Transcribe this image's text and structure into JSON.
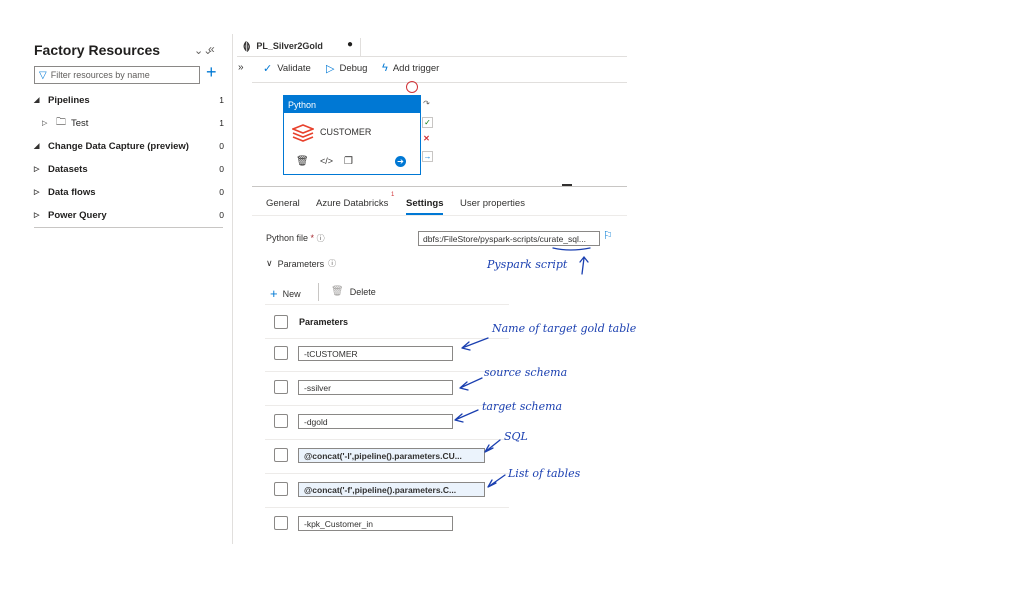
{
  "sidebar": {
    "title": "Factory Resources",
    "filter_placeholder": "Filter resources by name",
    "items": [
      {
        "label": "Pipelines",
        "count": "1",
        "expanded": true
      },
      {
        "label": "Test",
        "count": "1",
        "child": true
      },
      {
        "label": "Change Data Capture (preview)",
        "count": "0",
        "expanded": true
      },
      {
        "label": "Datasets",
        "count": "0"
      },
      {
        "label": "Data flows",
        "count": "0"
      },
      {
        "label": "Power Query",
        "count": "0"
      }
    ]
  },
  "tab": {
    "name": "PL_Silver2Gold",
    "unsaved_marker": "●"
  },
  "toolbar": {
    "validate": "Validate",
    "debug": "Debug",
    "add_trigger": "Add trigger"
  },
  "activity": {
    "type": "Python",
    "name": "CUSTOMER"
  },
  "props": {
    "tabs": [
      "General",
      "Azure Databricks",
      "Settings",
      "User properties"
    ],
    "badge": "1",
    "python_file_label": "Python file",
    "required_marker": "*",
    "python_file_value": "dbfs:/FileStore/pyspark-scripts/curate_sql...",
    "parameters_label": "Parameters",
    "new_label": "New",
    "delete_label": "Delete",
    "param_header": "Parameters",
    "params": [
      "-tCUSTOMER",
      "-ssilver",
      "-dgold",
      "@concat('-l',pipeline().parameters.CU...",
      "@concat('-f',pipeline().parameters.C...",
      "-kpk_Customer_in"
    ]
  },
  "annotations": {
    "script": "Pyspark script",
    "table": "Name of target gold table",
    "source": "source schema",
    "target": "target schema",
    "sql": "SQL",
    "tables": "List of tables"
  },
  "colors": {
    "accent": "#0078d4",
    "annotation": "#1a3fb0"
  }
}
